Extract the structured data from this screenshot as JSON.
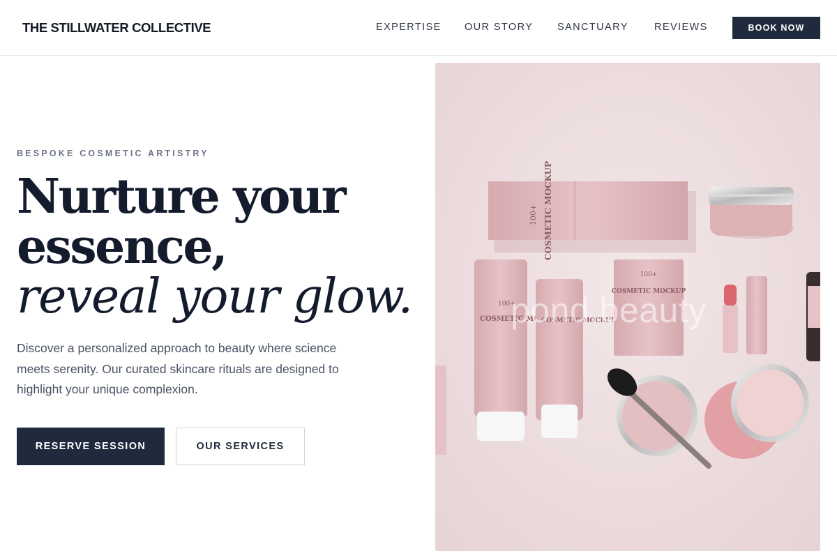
{
  "header": {
    "brand": "THE STILLWATER COLLECTIVE",
    "nav": [
      {
        "label": "EXPERTISE"
      },
      {
        "label": "OUR STORY"
      },
      {
        "label": "SANCTUARY"
      },
      {
        "label": "REVIEWS"
      }
    ],
    "cta": "BOOK NOW"
  },
  "hero": {
    "eyebrow": "BESPOKE COSMETIC ARTISTRY",
    "headline_line1": "Nurture your",
    "headline_line2": "essence,",
    "headline_line3": "reveal your glow.",
    "lead": "Discover a personalized approach to beauty where science meets serenity. Our curated skincare rituals are designed to highlight your unique complexion.",
    "primary_cta": "RESERVE SESSION",
    "secondary_cta": "OUR SERVICES"
  },
  "image": {
    "watermark": "pond.beauty",
    "labels": {
      "box_count": "100+",
      "box_title": "COSMETIC MOCKUP",
      "tube_count": "100+",
      "tube_title": "COSMETIC MOCKUP",
      "sachet_count": "100+",
      "sachet_title": "COSMETIC MOCKUP",
      "jar_title": "COSMETIC MOCKUP"
    }
  },
  "colors": {
    "primary_dark": "#1f2a3c",
    "headline": "#141b2d",
    "body_text": "#4a5264",
    "product_pink": "#dfb7bb",
    "image_bg": "#efe2e3"
  }
}
